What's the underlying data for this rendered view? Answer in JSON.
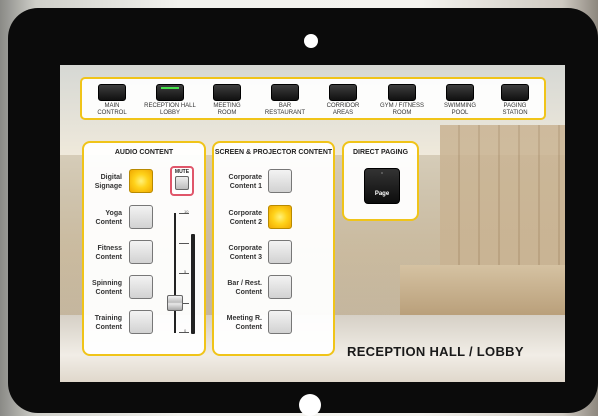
{
  "nav": {
    "items": [
      {
        "label": "MAIN\nCONTROL",
        "active": false
      },
      {
        "label": "RECEPTION HALL\nLOBBY",
        "active": true
      },
      {
        "label": "MEETING\nROOM",
        "active": false
      },
      {
        "label": "BAR\nRESTAURANT",
        "active": false
      },
      {
        "label": "CORRIDOR\nAREAS",
        "active": false
      },
      {
        "label": "GYM / FITNESS\nROOM",
        "active": false
      },
      {
        "label": "SWIMMING\nPOOL",
        "active": false
      },
      {
        "label": "PAGING\nSTATION",
        "active": false
      }
    ]
  },
  "audio": {
    "title": "AUDIO CONTENT",
    "mute_label": "MUTE",
    "sources": [
      {
        "label": "Digital\nSignage",
        "on": true
      },
      {
        "label": "Yoga\nContent",
        "on": false
      },
      {
        "label": "Fitness\nContent",
        "on": false
      },
      {
        "label": "Spinning\nContent",
        "on": false
      },
      {
        "label": "Training\nContent",
        "on": false
      }
    ],
    "fader_scale": [
      "10",
      "5",
      "0"
    ],
    "volume_level": 0.25
  },
  "screen": {
    "title": "SCREEN & PROJECTOR CONTENT",
    "sources": [
      {
        "label": "Corporate\nContent 1",
        "on": false
      },
      {
        "label": "Corporate\nContent 2",
        "on": true
      },
      {
        "label": "Corporate\nContent 3",
        "on": false
      },
      {
        "label": "Bar / Rest.\nContent",
        "on": false
      },
      {
        "label": "Meeting R.\nContent",
        "on": false
      }
    ]
  },
  "paging": {
    "title": "DIRECT PAGING",
    "button_label": "Page"
  },
  "room_title": "RECEPTION HALL / LOBBY",
  "colors": {
    "accent_border": "#f0c419",
    "active_button": "#ffd21a",
    "active_nav_led": "#48e04c",
    "mute_border": "#e0566a"
  }
}
